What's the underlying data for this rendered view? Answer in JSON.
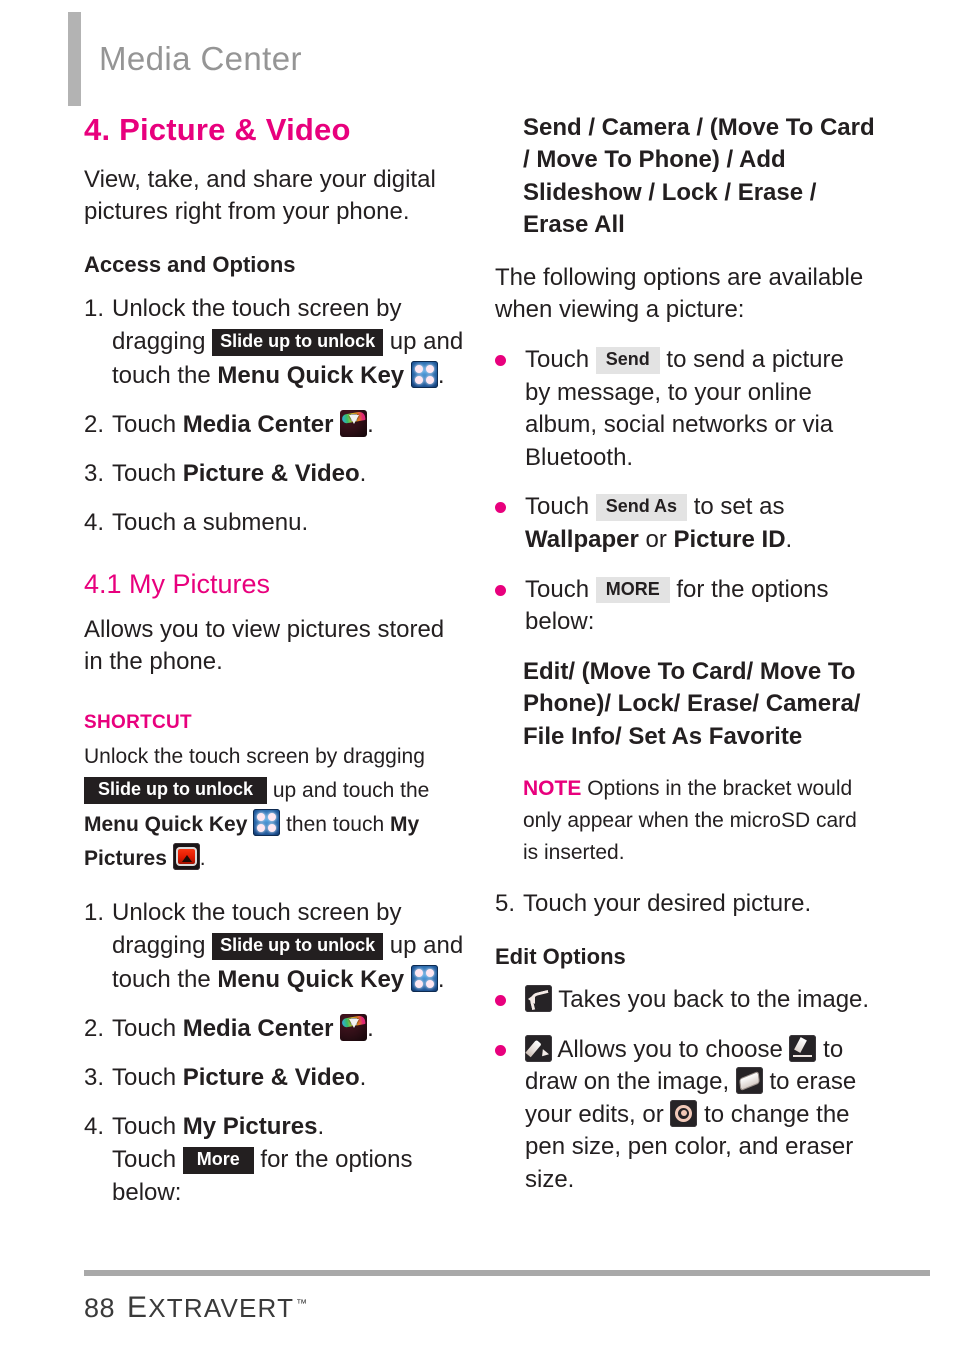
{
  "header": {
    "running_title": "Media Center"
  },
  "left_column": {
    "section_title": "4. Picture & Video",
    "intro": "View, take, and share your digital pictures right from your phone.",
    "access_heading": "Access and Options",
    "steps": [
      {
        "num": "1.",
        "text_a": "Unlock the touch screen by dragging",
        "chip": "Slide up to unlock",
        "text_b": "up and touch the",
        "bold": "Menu Quick Key",
        "icon": "menu-quick-key-icon",
        "text_c": "."
      },
      {
        "num": "2.",
        "text_a": "Touch",
        "bold": "Media Center",
        "icon": "media-center-icon",
        "text_c": "."
      },
      {
        "num": "3.",
        "text_a": "Touch",
        "bold": "Picture & Video",
        "text_c": "."
      },
      {
        "num": "4.",
        "text_a": "Touch a submenu."
      }
    ],
    "subsection_title": "4.1 My Pictures",
    "subsection_intro": "Allows you to view pictures stored in the phone.",
    "shortcut": {
      "label": "SHORTCUT",
      "text_a": "Unlock the touch screen by dragging",
      "chip": "Slide up to unlock",
      "text_b": "up and touch the",
      "bold_a": "Menu Quick Key",
      "icon_a": "menu-quick-key-icon",
      "text_c": "then touch",
      "bold_b": "My Pictures",
      "icon_b": "my-pictures-icon",
      "text_d": "."
    },
    "steps2": [
      {
        "num": "1.",
        "text_a": "Unlock the touch screen by dragging",
        "chip": "Slide up to unlock",
        "text_b": "up and touch the",
        "bold": "Menu Quick Key",
        "icon": "menu-quick-key-icon",
        "text_c": "."
      },
      {
        "num": "2.",
        "text_a": "Touch",
        "bold": "Media Center",
        "icon": "media-center-icon",
        "text_c": "."
      },
      {
        "num": "3.",
        "text_a": "Touch",
        "bold": "Picture & Video",
        "text_c": "."
      },
      {
        "num": "4.",
        "text_a": "Touch",
        "bold": "My Pictures",
        "text_c": ".",
        "text_d": "Touch",
        "chip2": "More",
        "text_e": "for the options below:"
      }
    ]
  },
  "right_column": {
    "options_list_1": "Send / Camera / (Move To Card / Move To Phone) / Add Slideshow / Lock / Erase / Erase All",
    "viewing_intro": "The following options are available when viewing a picture:",
    "bullets": [
      {
        "text_a": "Touch",
        "chip": "Send",
        "text_b": "to send a picture by message, to your online album, social networks or via Bluetooth."
      },
      {
        "text_a": "Touch",
        "chip": "Send As",
        "text_b": "to set as",
        "bold_a": "Wallpaper",
        "text_c": "or",
        "bold_b": "Picture ID",
        "text_d": "."
      },
      {
        "text_a": "Touch",
        "chip": "MORE",
        "text_b": "for the options below:"
      }
    ],
    "options_list_2": "Edit/ (Move To Card/ Move To Phone)/ Lock/ Erase/ Camera/ File Info/ Set As Favorite",
    "note": {
      "label": "NOTE",
      "text": "Options in the bracket would only appear when the microSD card is inserted."
    },
    "step5": {
      "num": "5.",
      "text": "Touch your desired picture."
    },
    "edit_options_heading": "Edit Options",
    "edit_bullets": [
      {
        "icon": "back-arrow-icon",
        "text_a": "Takes you back to the image."
      },
      {
        "icon": "pen-icon",
        "text_a": "Allows you to choose",
        "icon2": "pen-draw-icon",
        "text_b": "to draw on the image,",
        "icon3": "eraser-icon",
        "text_c": "to erase your edits, or",
        "icon4": "gear-icon",
        "text_d": "to change the pen size, pen color, and eraser size."
      }
    ]
  },
  "footer": {
    "page_number": "88",
    "brand_cap": "E",
    "brand_rest": "XTRAVERT",
    "trademark": "™"
  },
  "colors": {
    "accent_pink": "#e8007d",
    "header_gray": "#959595",
    "bar_gray": "#b3b3b3",
    "body_ink": "#231f20",
    "chip_dark": "#231f20",
    "chip_gray": "#e3e3e3"
  }
}
